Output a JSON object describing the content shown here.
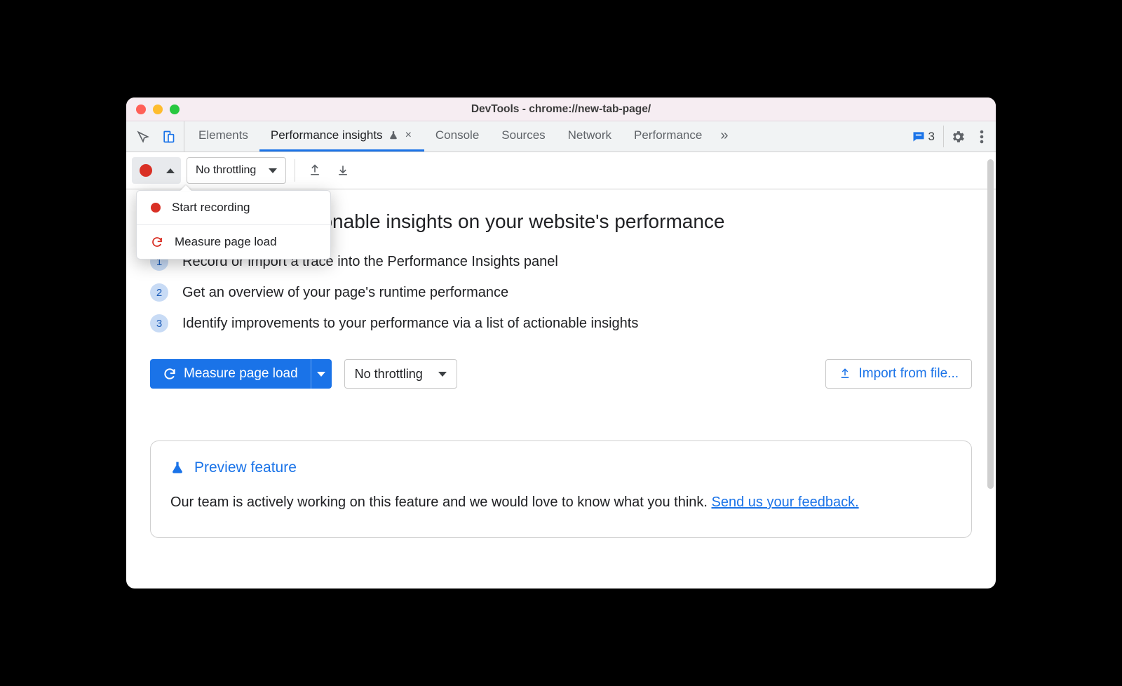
{
  "window": {
    "title": "DevTools - chrome://new-tab-page/"
  },
  "tabs": {
    "items": [
      "Elements",
      "Performance insights",
      "Console",
      "Sources",
      "Network",
      "Performance"
    ],
    "active_index": 1,
    "overflow_icon": "»"
  },
  "toolbar_right": {
    "message_count": "3"
  },
  "subtoolbar": {
    "throttle_label": "No throttling"
  },
  "dropdown": {
    "start_recording": "Start recording",
    "measure_page_load": "Measure page load"
  },
  "main": {
    "heading_partial": "hts on your website's performance",
    "heading_full": "Get actionable insights on your website's performance",
    "steps": {
      "s1_partial": "ace into the Performance Insights panel",
      "s1_full": "Record or import a trace into the Performance Insights panel",
      "s2": "Get an overview of your page's runtime performance",
      "s3": "Identify improvements to your performance via a list of actionable insights"
    },
    "measure_btn": "Measure page load",
    "throttle2": "No throttling",
    "import_btn": "Import from file..."
  },
  "card": {
    "title": "Preview feature",
    "body_prefix": "Our team is actively working on this feature and we would love to know what you think. ",
    "link": "Send us your feedback."
  }
}
